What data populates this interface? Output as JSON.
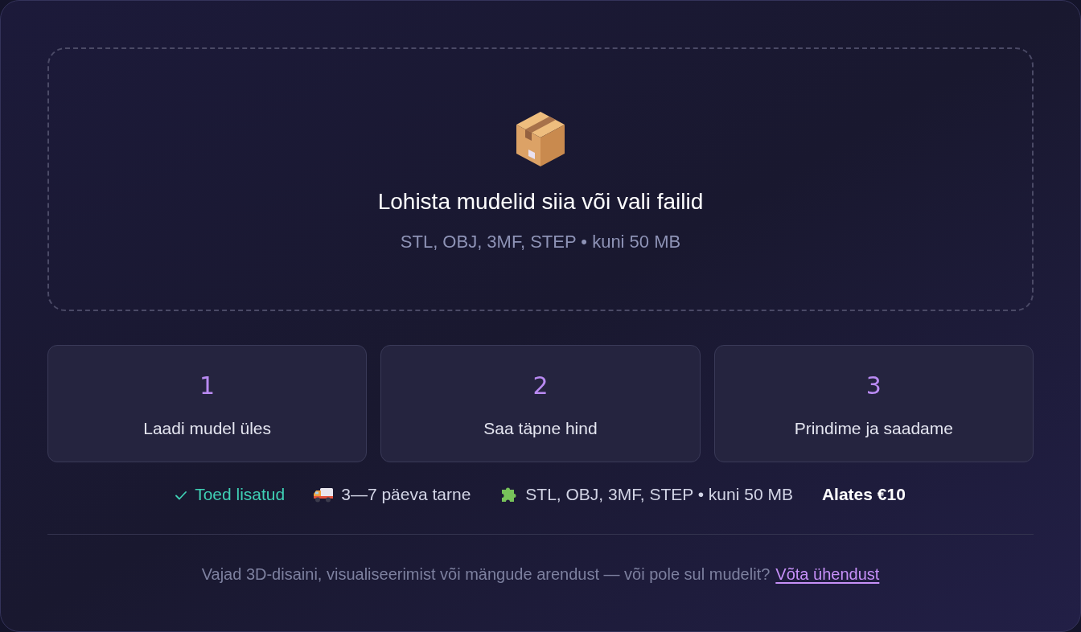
{
  "dropzone": {
    "title": "Lohista mudelid siia või vali failid",
    "subtitle": "STL, OBJ, 3MF, STEP • kuni 50 MB"
  },
  "steps": [
    {
      "number": "1",
      "label": "Laadi mudel üles"
    },
    {
      "number": "2",
      "label": "Saa täpne hind"
    },
    {
      "number": "3",
      "label": "Prindime ja saadame"
    }
  ],
  "features": [
    {
      "kind": "check",
      "text": "Toed lisatud"
    },
    {
      "kind": "truck",
      "text": "3—7 päeva tarne"
    },
    {
      "kind": "puzzle",
      "text": "STL, OBJ, 3MF, STEP • kuni 50 MB"
    },
    {
      "kind": "price",
      "text": "Alates €10"
    }
  ],
  "footer": {
    "text": "Vajad 3D-disaini, visualiseerimist või mängude arendust — või pole sul mudelit?",
    "link": "Võta ühendust"
  }
}
